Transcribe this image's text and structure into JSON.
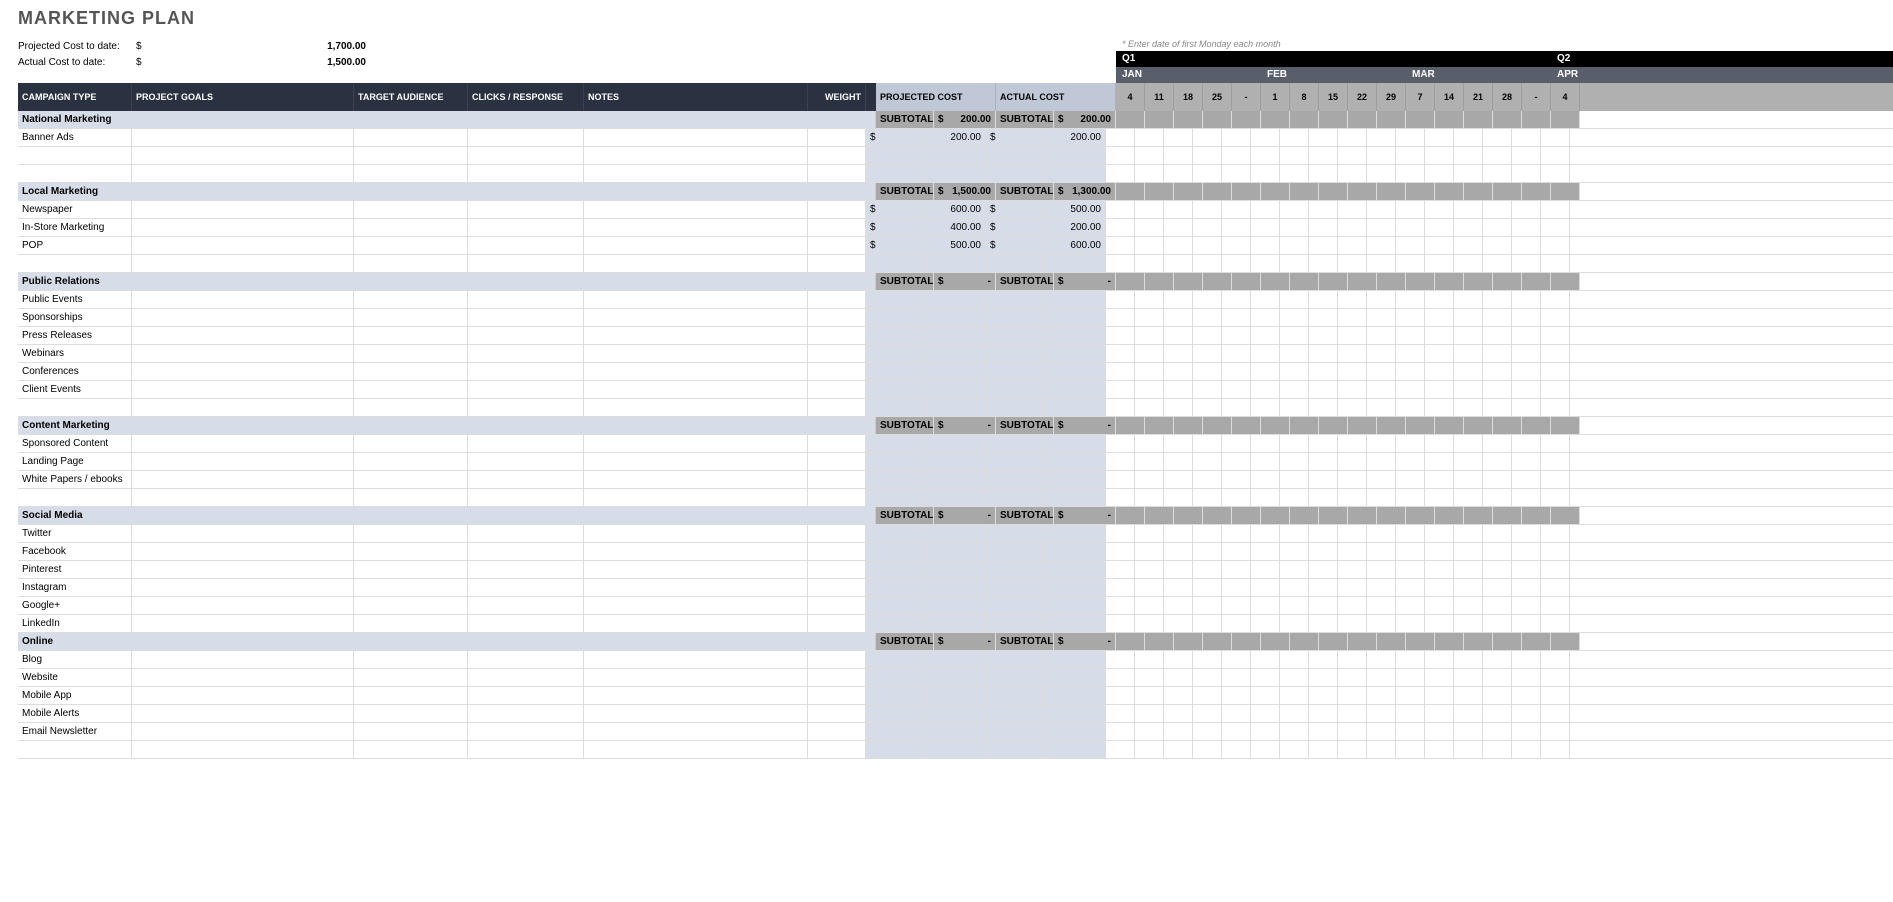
{
  "title": "MARKETING PLAN",
  "summary": {
    "projected_label": "Projected Cost to date:",
    "projected_curr": "$",
    "projected_val": "1,700.00",
    "actual_label": "Actual Cost to date:",
    "actual_curr": "$",
    "actual_val": "1,500.00"
  },
  "hint": "* Enter date of first Monday each month",
  "quarters": [
    "Q1",
    "Q2"
  ],
  "months": [
    "JAN",
    "FEB",
    "MAR",
    "APR"
  ],
  "month_spans": [
    5,
    5,
    5,
    1
  ],
  "headers": {
    "campaign": "CAMPAIGN TYPE",
    "goals": "PROJECT GOALS",
    "audience": "TARGET AUDIENCE",
    "clicks": "CLICKS / RESPONSE",
    "notes": "NOTES",
    "weight": "WEIGHT",
    "projected": "PROJECTED COST",
    "actual": "ACTUAL COST"
  },
  "dates": [
    "4",
    "11",
    "18",
    "25",
    "-",
    "1",
    "8",
    "15",
    "22",
    "29",
    "7",
    "14",
    "21",
    "28",
    "-",
    "4"
  ],
  "sections": [
    {
      "name": "National Marketing",
      "subtotal_label": "SUBTOTAL",
      "proj_sub": "200.00",
      "act_sub": "200.00",
      "items": [
        {
          "name": "Banner Ads",
          "proj": "200.00",
          "act": "200.00"
        },
        {
          "name": ""
        },
        {
          "name": ""
        }
      ]
    },
    {
      "name": "Local Marketing",
      "subtotal_label": "SUBTOTAL",
      "proj_sub": "1,500.00",
      "act_sub": "1,300.00",
      "items": [
        {
          "name": "Newspaper",
          "proj": "600.00",
          "act": "500.00"
        },
        {
          "name": "In-Store Marketing",
          "proj": "400.00",
          "act": "200.00"
        },
        {
          "name": "POP",
          "proj": "500.00",
          "act": "600.00"
        },
        {
          "name": ""
        }
      ]
    },
    {
      "name": "Public Relations",
      "subtotal_label": "SUBTOTAL",
      "proj_sub": "-",
      "act_sub": "-",
      "items": [
        {
          "name": "Public Events"
        },
        {
          "name": "Sponsorships"
        },
        {
          "name": "Press Releases"
        },
        {
          "name": "Webinars"
        },
        {
          "name": "Conferences"
        },
        {
          "name": "Client Events"
        },
        {
          "name": ""
        }
      ]
    },
    {
      "name": "Content Marketing",
      "subtotal_label": "SUBTOTAL",
      "proj_sub": "-",
      "act_sub": "-",
      "items": [
        {
          "name": "Sponsored Content"
        },
        {
          "name": "Landing Page"
        },
        {
          "name": "White Papers / ebooks"
        },
        {
          "name": ""
        }
      ]
    },
    {
      "name": "Social Media",
      "subtotal_label": "SUBTOTAL",
      "proj_sub": "-",
      "act_sub": "-",
      "items": [
        {
          "name": "Twitter"
        },
        {
          "name": "Facebook"
        },
        {
          "name": "Pinterest"
        },
        {
          "name": "Instagram"
        },
        {
          "name": "Google+"
        },
        {
          "name": "LinkedIn"
        }
      ]
    },
    {
      "name": "Online",
      "subtotal_label": "SUBTOTAL",
      "proj_sub": "-",
      "act_sub": "-",
      "items": [
        {
          "name": "Blog"
        },
        {
          "name": "Website"
        },
        {
          "name": "Mobile App"
        },
        {
          "name": "Mobile Alerts"
        },
        {
          "name": "Email Newsletter"
        },
        {
          "name": ""
        }
      ]
    }
  ],
  "currency": "$"
}
